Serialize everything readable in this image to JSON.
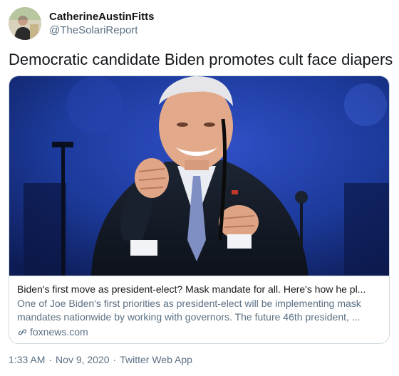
{
  "user": {
    "display_name": "CatherineAustinFitts",
    "handle": "@TheSolariReport"
  },
  "tweet": {
    "text": "Democratic candidate Biden promotes cult face diapers"
  },
  "card": {
    "title": "Biden's first move as president-elect? Mask mandate for all. Here's how he pl...",
    "description": "One of Joe Biden's first priorities as president-elect will be implementing mask mandates nationwide by working with governors. The future 46th president, ...",
    "source": "foxnews.com",
    "source_icon": "link-icon"
  },
  "meta": {
    "time": "1:33 AM",
    "separator": "·",
    "date": "Nov 9, 2020",
    "app": "Twitter Web App"
  },
  "colors": {
    "text": "#14171a",
    "secondary": "#5b7083",
    "border": "#cfd9de",
    "photo_background": "#1c3a9a"
  }
}
